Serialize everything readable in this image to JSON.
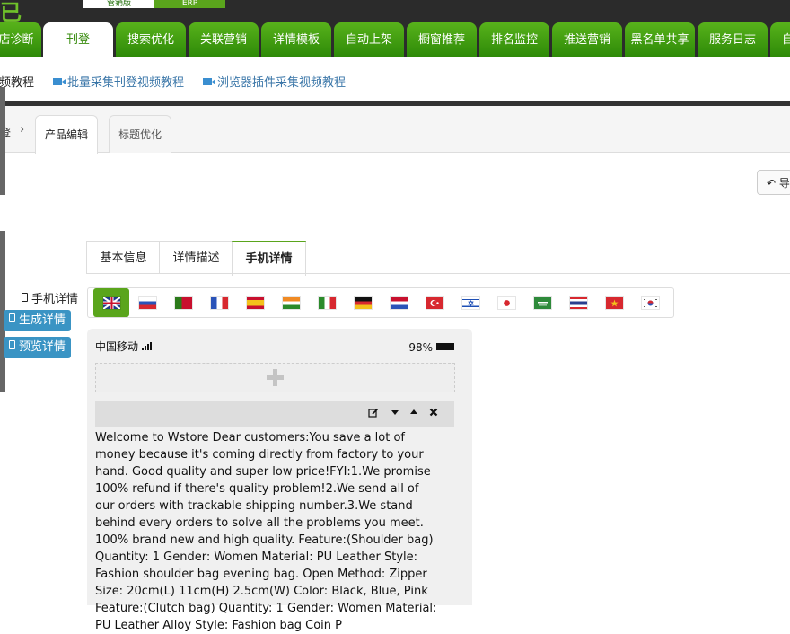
{
  "topbar": {
    "logo": "已",
    "switch_left": "管销版",
    "switch_right": "ERP"
  },
  "nav": {
    "tabs": [
      "店诊断",
      "刊登",
      "搜索优化",
      "关联营销",
      "详情模板",
      "自动上架",
      "橱窗推荐",
      "排名监控",
      "推送营销",
      "黑名单共享",
      "服务日志",
      "自"
    ],
    "active": "刊登"
  },
  "links": [
    "频教程",
    "批量采集刊登视频教程",
    "浏览器插件采集视频教程"
  ],
  "breadcrumb": {
    "prefix": "登",
    "separator": "›",
    "tabs": [
      "产品编辑",
      "标题优化"
    ],
    "active": "产品编辑"
  },
  "back_button": {
    "label": "导"
  },
  "subtabs": {
    "items": [
      "基本信息",
      "详情描述",
      "手机详情"
    ],
    "active": "手机详情"
  },
  "left_menu": {
    "title": "手机详情",
    "generate": "生成详情",
    "preview": "预览详情"
  },
  "flags": {
    "items": [
      "uk-flag",
      "ru-flag",
      "pt-flag",
      "fr-flag",
      "es-flag",
      "in-flag",
      "it-flag",
      "de-flag",
      "nl-flag",
      "tr-flag",
      "il-flag",
      "jp-flag",
      "sa-flag",
      "th-flag",
      "vn-flag",
      "kr-flag"
    ],
    "active": "uk-flag"
  },
  "phone": {
    "carrier": "中国移动",
    "battery": "98%",
    "toolbar_icons": [
      "edit-icon",
      "move-down-icon",
      "move-up-icon",
      "delete-icon"
    ],
    "content": "Welcome to Wstore Dear customers:You save a lot of money because it's coming directly from factory to your hand. Good quality and super low price!FYI:1.We promise 100% refund if there's quality problem!2.We send all of our orders with trackable shipping number.3.We stand behind every orders to solve all the problems you meet. 100% brand new and high quality. Feature:(Shoulder bag) Quantity: 1 Gender: Women Material: PU Leather Style: Fashion shoulder bag evening bag. Open Method: Zipper Size: 20cm(L) 11cm(H) 2.5cm(W) Color: Black, Blue, Pink Feature:(Clutch bag) Quantity: 1 Gender: Women Material: PU Leather Alloy Style: Fashion bag Coin P"
  },
  "colors": {
    "nav_green": "#3f9b11",
    "accent_blue": "#3a94c4",
    "link_blue": "#3a76a8"
  }
}
